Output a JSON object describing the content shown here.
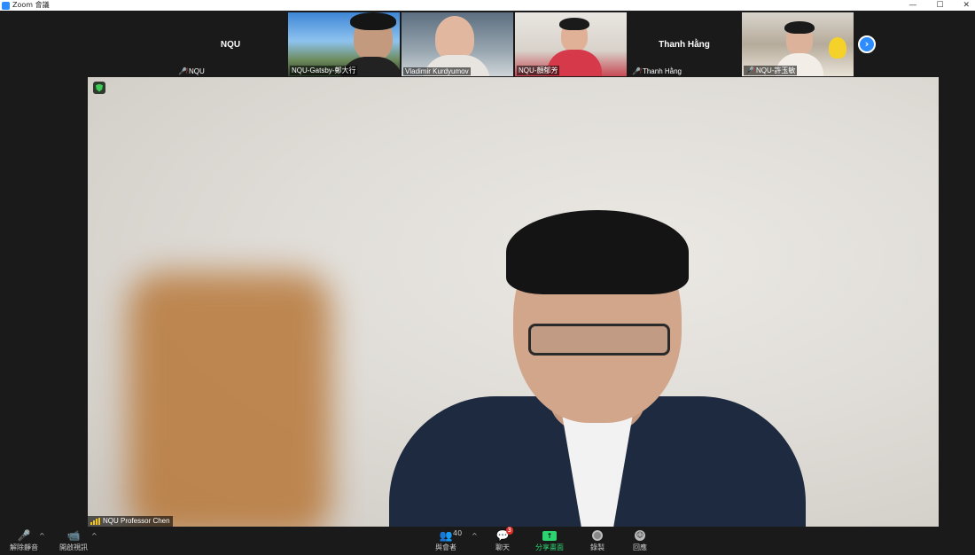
{
  "window": {
    "title": "Zoom 會議",
    "controls": [
      "—",
      "☐",
      "✕"
    ]
  },
  "gallery": {
    "tiles": [
      {
        "id": "nqu",
        "big_name": "NQU",
        "label": "NQU",
        "muted": true
      },
      {
        "id": "gatsby",
        "label": "NQU-Gatsby-鄭大行",
        "muted": false
      },
      {
        "id": "vladimir",
        "label": "Vladimir Kurdyumov",
        "muted": false
      },
      {
        "id": "yen",
        "label": "NQU-顏郁芳",
        "muted": false
      },
      {
        "id": "thanh",
        "big_name": "Thanh Hằng",
        "label": "Thanh Hằng",
        "muted": true
      },
      {
        "id": "hsu",
        "label": "NQU-許玉敏",
        "muted": true
      }
    ],
    "next_symbol": "›"
  },
  "main_video": {
    "speaker_label": "NQU Professor Chen"
  },
  "toolbar": {
    "unmute_label": "解除靜音",
    "start_video_label": "開啟視訊",
    "participants_label": "與會者",
    "participants_count": "40",
    "chat_label": "聊天",
    "chat_badge": "3",
    "share_label": "分享畫面",
    "share_symbol": "↑",
    "record_label": "錄製",
    "reactions_label": "回應",
    "caret": "^"
  },
  "colors": {
    "accent": "#2d8cff",
    "share_green": "#2dd36f",
    "muted_red": "#e0302a"
  }
}
